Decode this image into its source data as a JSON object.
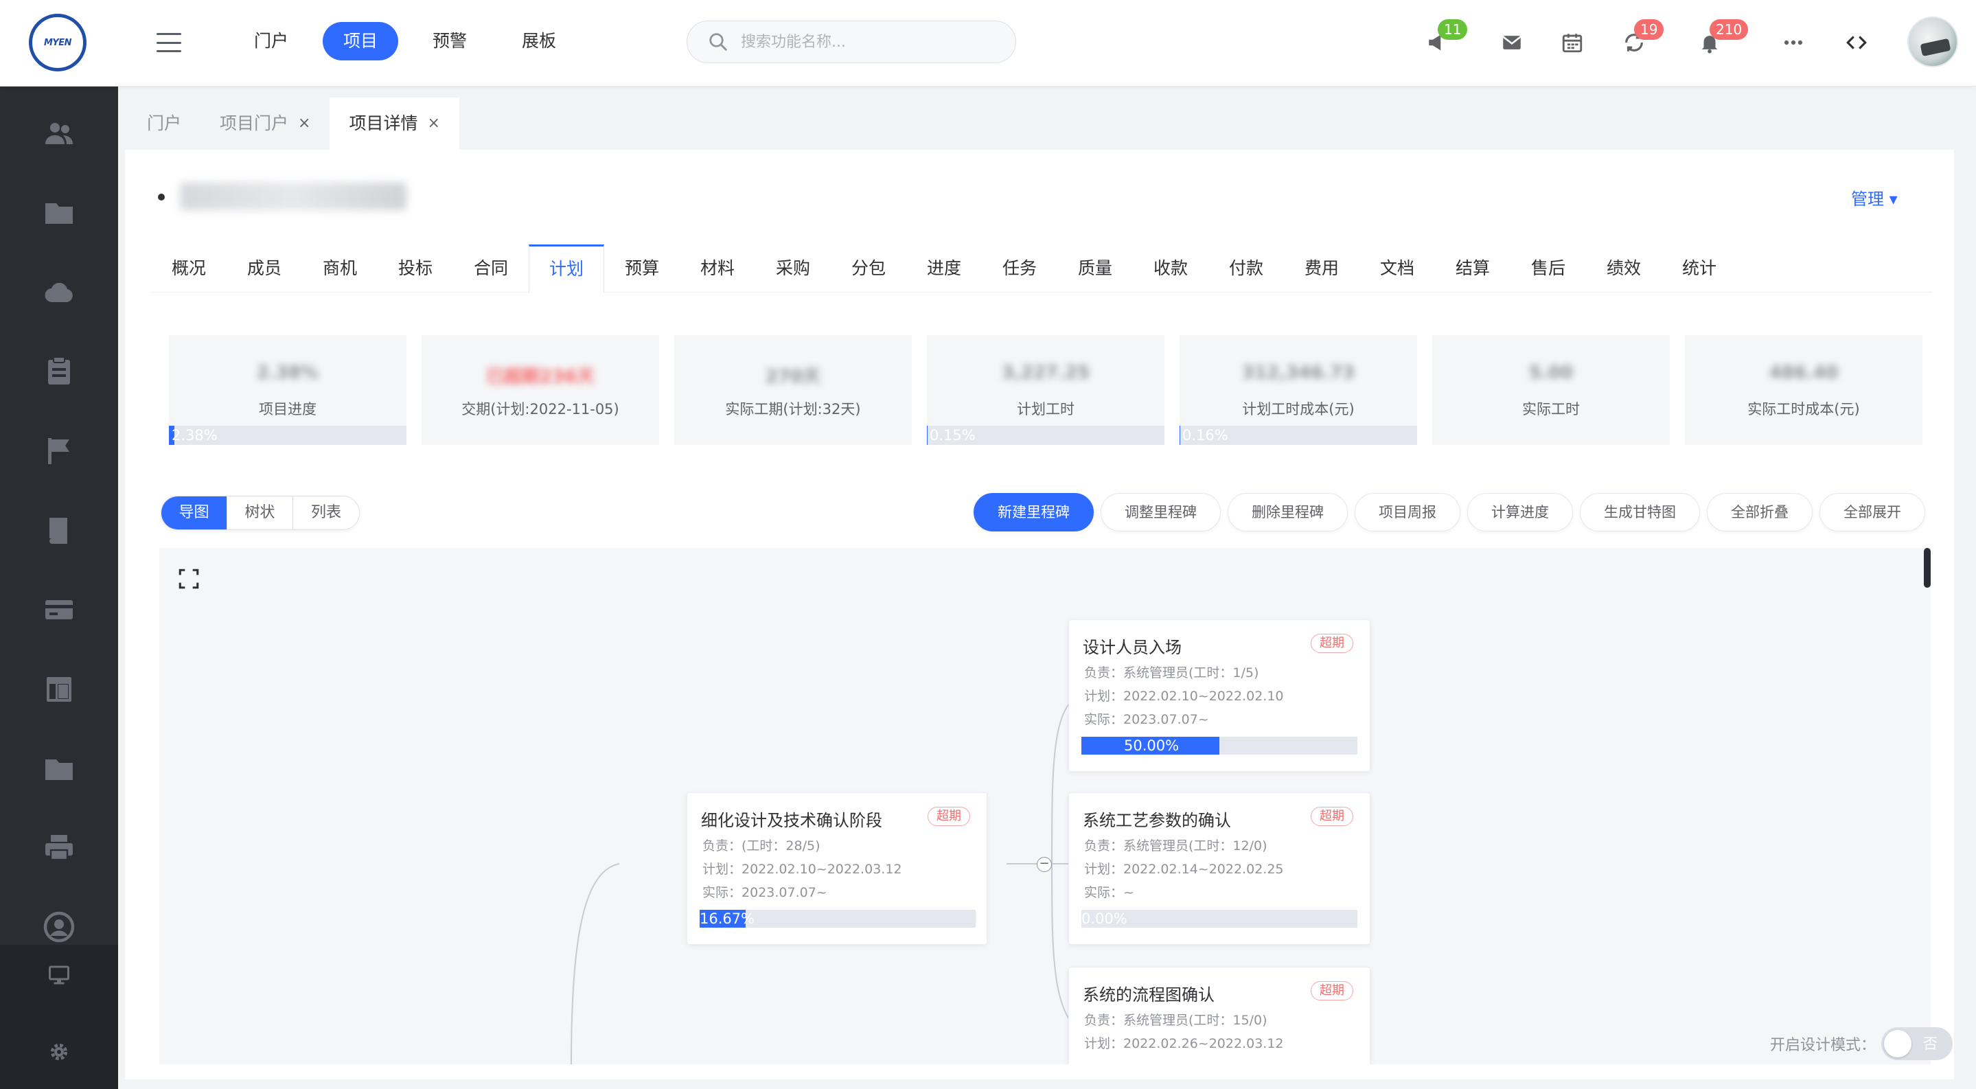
{
  "logo": {
    "text": "MYEN"
  },
  "topnav": {
    "items": [
      "门户",
      "项目",
      "预警",
      "展板"
    ],
    "active": 1
  },
  "search": {
    "placeholder": "搜索功能名称..."
  },
  "header_icons": [
    {
      "name": "megaphone-icon",
      "badge": "11",
      "badge_color": "#67c23a"
    },
    {
      "name": "mail-icon"
    },
    {
      "name": "calendar-icon"
    },
    {
      "name": "sync-icon",
      "badge": "19",
      "badge_color": "#f56c6c"
    },
    {
      "name": "bell-icon",
      "badge": "210",
      "badge_color": "#f56c6c"
    },
    {
      "name": "more-icon"
    },
    {
      "name": "code-icon"
    }
  ],
  "sidebar": {
    "icons": [
      "users-icon",
      "folder-icon",
      "cloud-icon",
      "clipboard-icon",
      "flag-icon",
      "book-icon",
      "card-icon",
      "layout-icon",
      "folder-icon",
      "printer-icon",
      "user-circle-icon",
      "monitor-icon",
      "gear-icon"
    ]
  },
  "tabs": [
    {
      "label": "门户",
      "closable": false
    },
    {
      "label": "项目门户",
      "closable": true
    },
    {
      "label": "项目详情",
      "closable": true,
      "active": true
    }
  ],
  "tab_close": "×",
  "project": {
    "manage_label": "管理 ▾"
  },
  "subtabs": {
    "items": [
      "概况",
      "成员",
      "商机",
      "投标",
      "合同",
      "计划",
      "预算",
      "材料",
      "采购",
      "分包",
      "进度",
      "任务",
      "质量",
      "收款",
      "付款",
      "费用",
      "文档",
      "结算",
      "售后",
      "绩效",
      "统计"
    ],
    "active": 5
  },
  "stats": [
    {
      "label": "项目进度",
      "value": "2.38%",
      "progress": 2.38,
      "progress_label": "2.38%"
    },
    {
      "label": "交期(计划:2022-11-05)",
      "value": "已超期236天",
      "value_color": "red"
    },
    {
      "label": "实际工期(计划:32天)",
      "value": "270天"
    },
    {
      "label": "计划工时",
      "value": "3,227.25",
      "progress": 0.15,
      "progress_label": "0.15%"
    },
    {
      "label": "计划工时成本(元)",
      "value": "312,346.73",
      "progress": 0.16,
      "progress_label": "0.16%"
    },
    {
      "label": "实际工时",
      "value": "5.00"
    },
    {
      "label": "实际工时成本(元)",
      "value": "486.40"
    }
  ],
  "view_toggle": {
    "items": [
      "导图",
      "树状",
      "列表"
    ],
    "active": 0
  },
  "actions": [
    {
      "label": "新建里程碑",
      "primary": true
    },
    {
      "label": "调整里程碑"
    },
    {
      "label": "删除里程碑"
    },
    {
      "label": "项目周报"
    },
    {
      "label": "计算进度"
    },
    {
      "label": "生成甘特图"
    },
    {
      "label": "全部折叠"
    },
    {
      "label": "全部展开"
    }
  ],
  "mindmap": {
    "root": {
      "title": "细化设计及技术确认阶段",
      "tag": "超期",
      "owner": "负责：(工时：28/5)",
      "plan": "计划：2022.02.10~2022.03.12",
      "actual": "实际：2023.07.07~",
      "progress": 16.67,
      "progress_label": "16.67%"
    },
    "collapse_label": "−",
    "children": [
      {
        "title": "设计人员入场",
        "tag": "超期",
        "owner": "负责：系统管理员(工时：1/5)",
        "plan": "计划：2022.02.10~2022.02.10",
        "actual": "实际：2023.07.07~",
        "progress": 50,
        "progress_label": "50.00%"
      },
      {
        "title": "系统工艺参数的确认",
        "tag": "超期",
        "owner": "负责：系统管理员(工时：12/0)",
        "plan": "计划：2022.02.14~2022.02.25",
        "actual": "实际：~",
        "progress": 0,
        "progress_label": "0.00%"
      },
      {
        "title": "系统的流程图确认",
        "tag": "超期",
        "owner": "负责：系统管理员(工时：15/0)",
        "plan": "计划：2022.02.26~2022.03.12"
      }
    ]
  },
  "design_mode": {
    "label": "开启设计模式：",
    "toggle_label": "否"
  }
}
